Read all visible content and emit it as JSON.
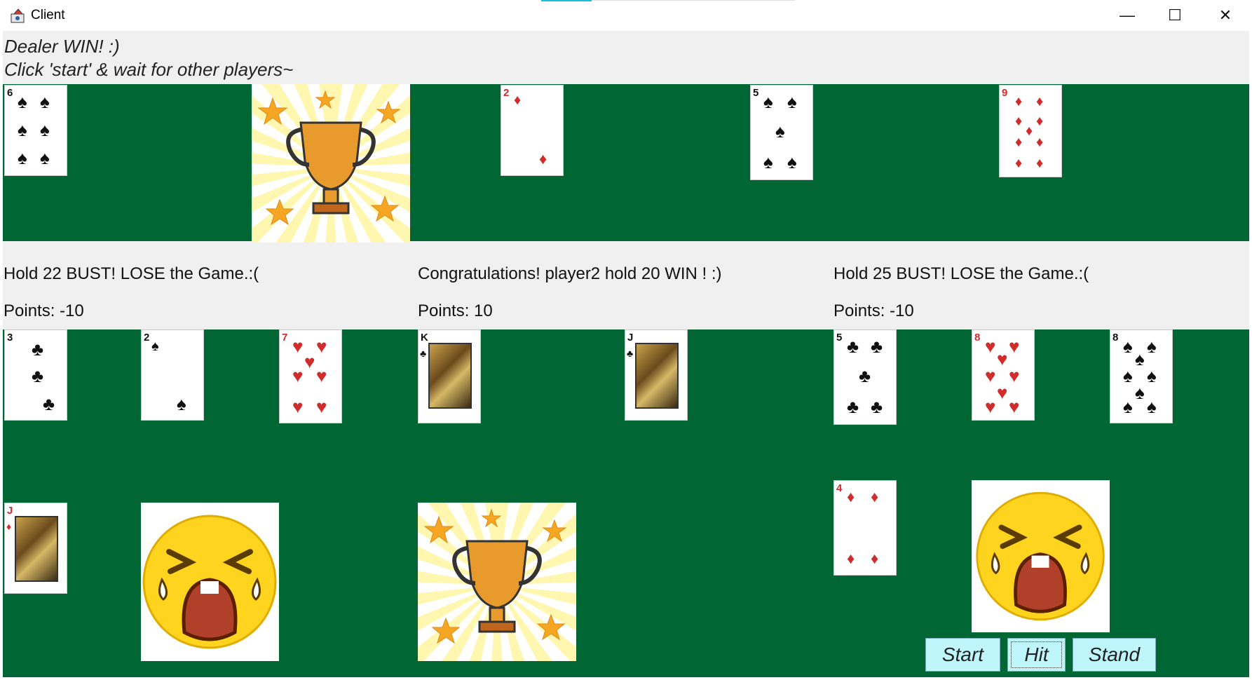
{
  "window": {
    "title": "Client",
    "minimize_glyph": "—",
    "maximize_glyph": "☐",
    "close_glyph": "✕"
  },
  "status": {
    "line1": "Dealer WIN! :)",
    "line2": "Click 'start' & wait for other players~"
  },
  "players": [
    {
      "message": "Hold 22 BUST! LOSE the Game.:(",
      "points": "Points: -10",
      "result": "lose"
    },
    {
      "message": "Congratulations! player2 hold 20 WIN ! :)",
      "points": "Points: 10",
      "result": "win"
    },
    {
      "message": "Hold 25 BUST! LOSE the Game.:(",
      "points": "Points: -10",
      "result": "lose"
    }
  ],
  "dealer_cards": [
    {
      "rank": "6",
      "suit": "♠",
      "color": "black"
    },
    {
      "rank": "2",
      "suit": "♦",
      "color": "red"
    },
    {
      "rank": "5",
      "suit": "♠",
      "color": "black"
    },
    {
      "rank": "9",
      "suit": "♦",
      "color": "red"
    }
  ],
  "player_cards": {
    "p1": [
      {
        "rank": "3",
        "suit": "♣",
        "color": "black"
      },
      {
        "rank": "2",
        "suit": "♠",
        "color": "black"
      },
      {
        "rank": "7",
        "suit": "♥",
        "color": "red"
      },
      {
        "rank": "J",
        "suit": "♦",
        "color": "red"
      }
    ],
    "p2": [
      {
        "rank": "K",
        "suit": "♣",
        "color": "black"
      },
      {
        "rank": "J",
        "suit": "♣",
        "color": "black"
      }
    ],
    "p3": [
      {
        "rank": "5",
        "suit": "♣",
        "color": "black"
      },
      {
        "rank": "8",
        "suit": "♥",
        "color": "red"
      },
      {
        "rank": "8",
        "suit": "♠",
        "color": "black"
      },
      {
        "rank": "4",
        "suit": "♦",
        "color": "red"
      }
    ]
  },
  "buttons": {
    "start": "Start",
    "hit": "Hit",
    "stand": "Stand"
  },
  "colors": {
    "felt": "#006634",
    "button_bg": "#bff6fb",
    "titlebar_accent": "#17c2d6"
  },
  "icons": {
    "win": "trophy-icon",
    "lose": "crying-face-icon",
    "app": "java-app-icon"
  }
}
